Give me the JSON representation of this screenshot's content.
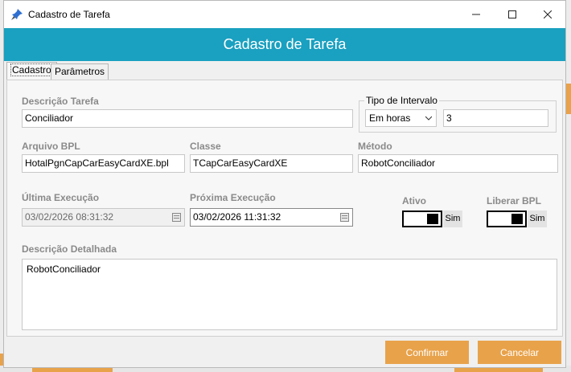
{
  "window": {
    "title": "Cadastro de Tarefa",
    "header": "Cadastro de Tarefa"
  },
  "tabs": [
    {
      "label": "Cadastro",
      "active": true
    },
    {
      "label": "Parâmetros",
      "active": false
    }
  ],
  "form": {
    "descricao_tarefa": {
      "label": "Descrição Tarefa",
      "value": "Conciliador"
    },
    "tipo_intervalo": {
      "label": "Tipo de Intervalo",
      "unit": "Em horas",
      "value": "3"
    },
    "arquivo_bpl": {
      "label": "Arquivo BPL",
      "value": "HotalPgnCapCarEasyCardXE.bpl"
    },
    "classe": {
      "label": "Classe",
      "value": "TCapCarEasyCardXE"
    },
    "metodo": {
      "label": "Método",
      "value": "RobotConciliador"
    },
    "ultima_execucao": {
      "label": "Última Execução",
      "value": "03/02/2026 08:31:32"
    },
    "proxima_execucao": {
      "label": "Próxima Execução",
      "value": "03/02/2026 11:31:32"
    },
    "ativo": {
      "label": "Ativo",
      "state": "Sim"
    },
    "liberar_bpl": {
      "label": "Liberar BPL",
      "state": "Sim"
    },
    "descricao_detalhada": {
      "label": "Descrição Detalhada",
      "value": "RobotConciliador"
    }
  },
  "buttons": {
    "confirm": "Confirmar",
    "cancel": "Cancelar"
  },
  "colors": {
    "header": "#1aa0c0",
    "button": "#e8a24a"
  }
}
